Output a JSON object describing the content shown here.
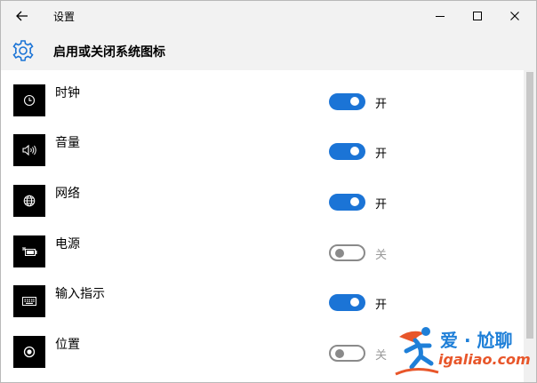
{
  "titlebar": {
    "title": "设置"
  },
  "header": {
    "title": "启用或关闭系统图标"
  },
  "rows": [
    {
      "label": "时钟",
      "state": "开",
      "on": true,
      "icon": "clock-icon"
    },
    {
      "label": "音量",
      "state": "开",
      "on": true,
      "icon": "volume-icon"
    },
    {
      "label": "网络",
      "state": "开",
      "on": true,
      "icon": "globe-icon"
    },
    {
      "label": "电源",
      "state": "关",
      "on": false,
      "icon": "battery-icon"
    },
    {
      "label": "输入指示",
      "state": "开",
      "on": true,
      "icon": "keyboard-icon"
    },
    {
      "label": "位置",
      "state": "关",
      "on": false,
      "icon": "location-icon"
    }
  ],
  "watermark": {
    "title": "爱 · 尬聊",
    "url": "igaliao.com"
  },
  "colors": {
    "accent": "#1b74d6",
    "toggle_off": "#8a8a8a",
    "header_bg": "#f2f2f2"
  }
}
